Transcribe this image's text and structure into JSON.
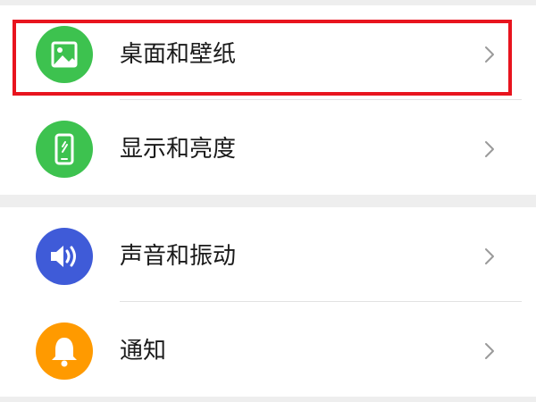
{
  "settings": {
    "group1": [
      {
        "label": "桌面和壁纸",
        "icon": "image-icon",
        "icon_color": "#3dc24f"
      },
      {
        "label": "显示和亮度",
        "icon": "phone-display-icon",
        "icon_color": "#3dc24f"
      }
    ],
    "group2": [
      {
        "label": "声音和振动",
        "icon": "speaker-icon",
        "icon_color": "#3f5bd8"
      },
      {
        "label": "通知",
        "icon": "bell-icon",
        "icon_color": "#ff9a00"
      }
    ]
  },
  "highlight": {
    "target": "桌面和壁纸",
    "color": "#e8141e"
  },
  "colors": {
    "background": "#eeeeee",
    "card": "#ffffff",
    "text": "#1a1a1a",
    "chevron": "#9a9a9a",
    "divider": "#e2e2e2"
  }
}
